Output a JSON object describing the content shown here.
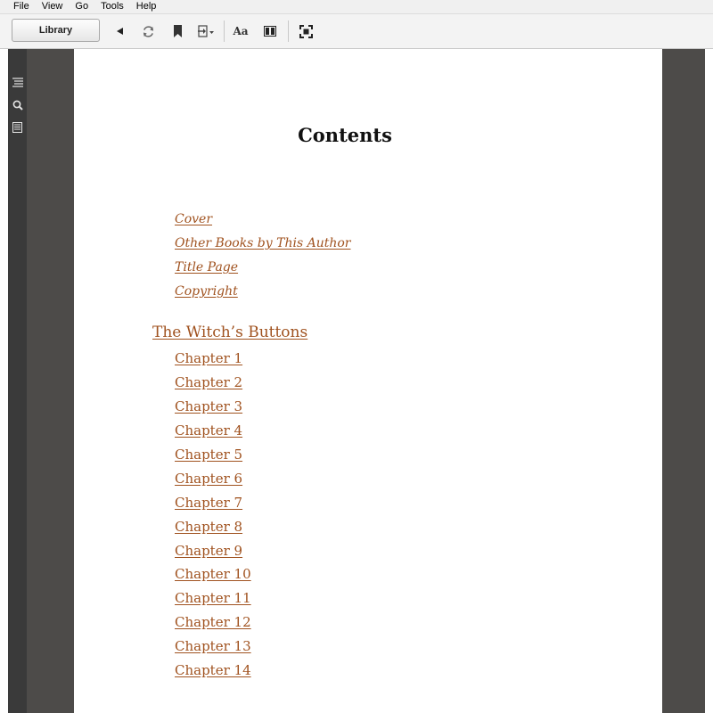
{
  "menu": [
    "File",
    "View",
    "Go",
    "Tools",
    "Help"
  ],
  "toolbar": {
    "library_label": "Library",
    "font_icon_label": "Aa"
  },
  "toc": {
    "title": "Contents",
    "front_matter": [
      "Cover",
      "Other Books by This Author",
      "Title Page",
      "Copyright"
    ],
    "part_title": "The Witch’s Buttons",
    "chapters": [
      "Chapter 1",
      "Chapter 2",
      "Chapter 3",
      "Chapter 4",
      "Chapter 5",
      "Chapter 6",
      "Chapter 7",
      "Chapter 8",
      "Chapter 9",
      "Chapter 10",
      "Chapter 11",
      "Chapter 12",
      "Chapter 13",
      "Chapter 14"
    ]
  },
  "colors": {
    "link": "#a0521f",
    "gutter": "#4d4b49",
    "sidebar": "#3a3a3a"
  }
}
